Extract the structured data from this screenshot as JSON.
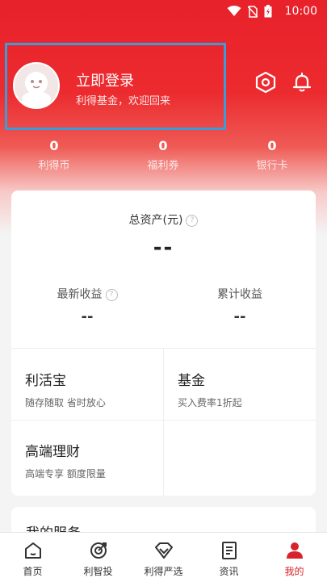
{
  "status_bar": {
    "time": "10:00",
    "icons": [
      "wifi-icon",
      "no-sim-icon",
      "battery-icon"
    ]
  },
  "profile": {
    "title": "立即登录",
    "subtitle": "利得基金，欢迎回来"
  },
  "header_icons": [
    "settings-hexagon-icon",
    "bell-icon"
  ],
  "stats": [
    {
      "value": "0",
      "label": "利得币"
    },
    {
      "value": "0",
      "label": "福利券"
    },
    {
      "value": "0",
      "label": "银行卡"
    }
  ],
  "assets": {
    "total_label": "总资产(元)",
    "total_value": "--",
    "latest_label": "最新收益",
    "latest_value": "--",
    "cumulative_label": "累计收益",
    "cumulative_value": "--"
  },
  "products": [
    {
      "title": "利活宝",
      "desc": "随存随取 省时放心"
    },
    {
      "title": "基金",
      "desc": "买入费率1折起"
    },
    {
      "title": "高端理财",
      "desc": "高端专享 额度限量"
    }
  ],
  "services": {
    "title": "我的服务"
  },
  "tabs": [
    {
      "label": "首页",
      "icon": "home-icon",
      "active": false
    },
    {
      "label": "利智投",
      "icon": "target-icon",
      "active": false
    },
    {
      "label": "利得严选",
      "icon": "diamond-icon",
      "active": false
    },
    {
      "label": "资讯",
      "icon": "news-icon",
      "active": false
    },
    {
      "label": "我的",
      "icon": "person-icon",
      "active": true
    }
  ],
  "colors": {
    "brand_red": "#e8212a",
    "highlight_blue": "#3d9bd8",
    "active_tab": "#d9232b"
  }
}
